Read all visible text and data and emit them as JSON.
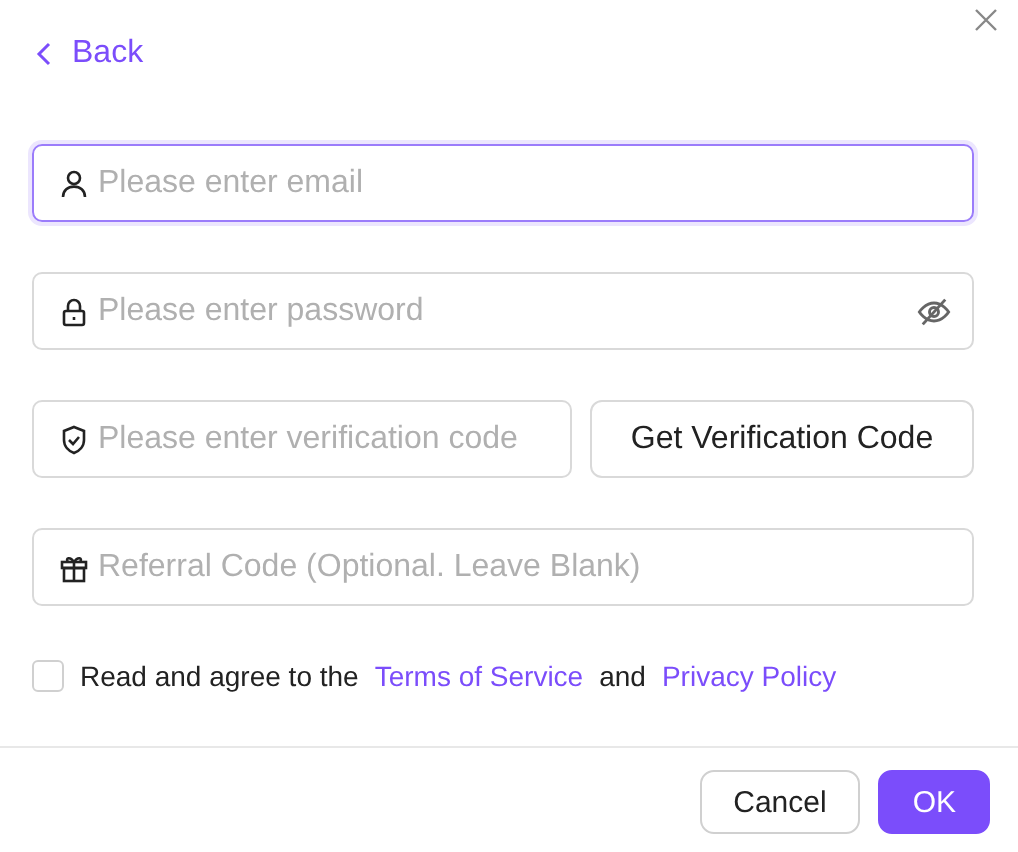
{
  "back": {
    "label": "Back"
  },
  "fields": [
    {
      "kind": "email",
      "placeholder": "Please enter email",
      "focused": true
    },
    {
      "kind": "password",
      "placeholder": "Please enter password",
      "focused": false
    },
    {
      "kind": "code",
      "placeholder": "Please enter verification code",
      "focused": false,
      "action": "Get Verification Code"
    },
    {
      "kind": "referral",
      "placeholder": "Referral Code (Optional. Leave Blank)",
      "focused": false
    }
  ],
  "agreement": {
    "checked": false,
    "parts": [
      {
        "kind": "text",
        "text": "Read and agree to the"
      },
      {
        "kind": "link",
        "text": "Terms of Service"
      },
      {
        "kind": "text",
        "text": "and"
      },
      {
        "kind": "link",
        "text": "Privacy Policy"
      }
    ]
  },
  "buttons": [
    {
      "kind": "secondary",
      "label": "Cancel"
    },
    {
      "kind": "primary",
      "label": "OK"
    }
  ]
}
